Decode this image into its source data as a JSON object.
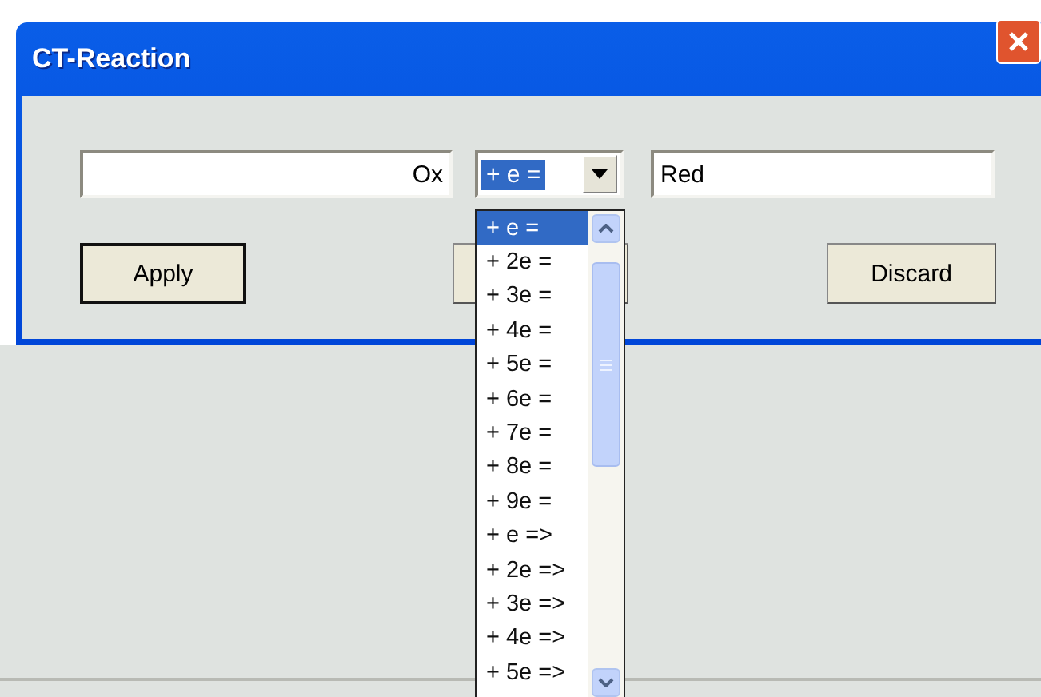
{
  "window": {
    "title": "CT-Reaction"
  },
  "fields": {
    "oxidized": {
      "value": "Ox"
    },
    "combo": {
      "value": "+ e ="
    },
    "reduced": {
      "value": "Red"
    }
  },
  "buttons": [
    {
      "label": "Apply"
    },
    {
      "label": "Discard"
    }
  ],
  "dropdown": {
    "items": [
      {
        "label": "+ e =",
        "selected": true
      },
      {
        "label": "+ 2e =",
        "selected": false
      },
      {
        "label": "+ 3e =",
        "selected": false
      },
      {
        "label": "+ 4e =",
        "selected": false
      },
      {
        "label": "+ 5e =",
        "selected": false
      },
      {
        "label": "+ 6e =",
        "selected": false
      },
      {
        "label": "+ 7e =",
        "selected": false
      },
      {
        "label": "+ 8e =",
        "selected": false
      },
      {
        "label": "+ 9e =",
        "selected": false
      },
      {
        "label": "+ e =>",
        "selected": false
      },
      {
        "label": "+ 2e =>",
        "selected": false
      },
      {
        "label": "+ 3e =>",
        "selected": false
      },
      {
        "label": "+ 4e =>",
        "selected": false
      },
      {
        "label": "+ 5e =>",
        "selected": false
      }
    ]
  }
}
